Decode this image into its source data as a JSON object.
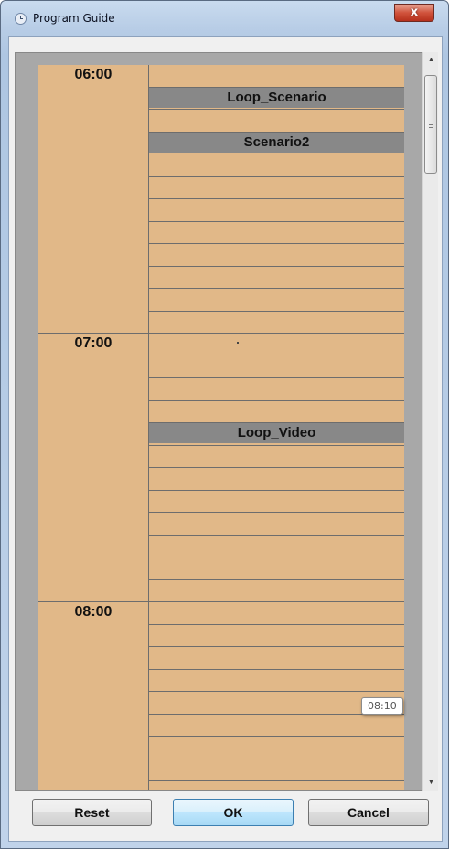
{
  "window": {
    "title": "Program Guide",
    "close_glyph": "x"
  },
  "guide": {
    "hours": [
      {
        "label": "06:00"
      },
      {
        "label": "07:00"
      },
      {
        "label": "08:00"
      }
    ],
    "events": [
      {
        "label": "Loop_Scenario",
        "start": "06:05",
        "end": "06:10"
      },
      {
        "label": "Scenario2",
        "start": "06:15",
        "end": "06:20"
      },
      {
        "label": "Loop_Video",
        "start": "07:20",
        "end": "07:25"
      }
    ],
    "tooltip": "08:10"
  },
  "buttons": {
    "reset": "Reset",
    "ok": "OK",
    "cancel": "Cancel"
  },
  "icons": {
    "title": "clock-icon",
    "close": "close-icon",
    "scroll_up": "arrow-up-icon",
    "scroll_down": "arrow-down-icon"
  },
  "colors": {
    "slot_background": "#e1b888",
    "event_background": "#888888",
    "close_button": "#c7422c"
  }
}
